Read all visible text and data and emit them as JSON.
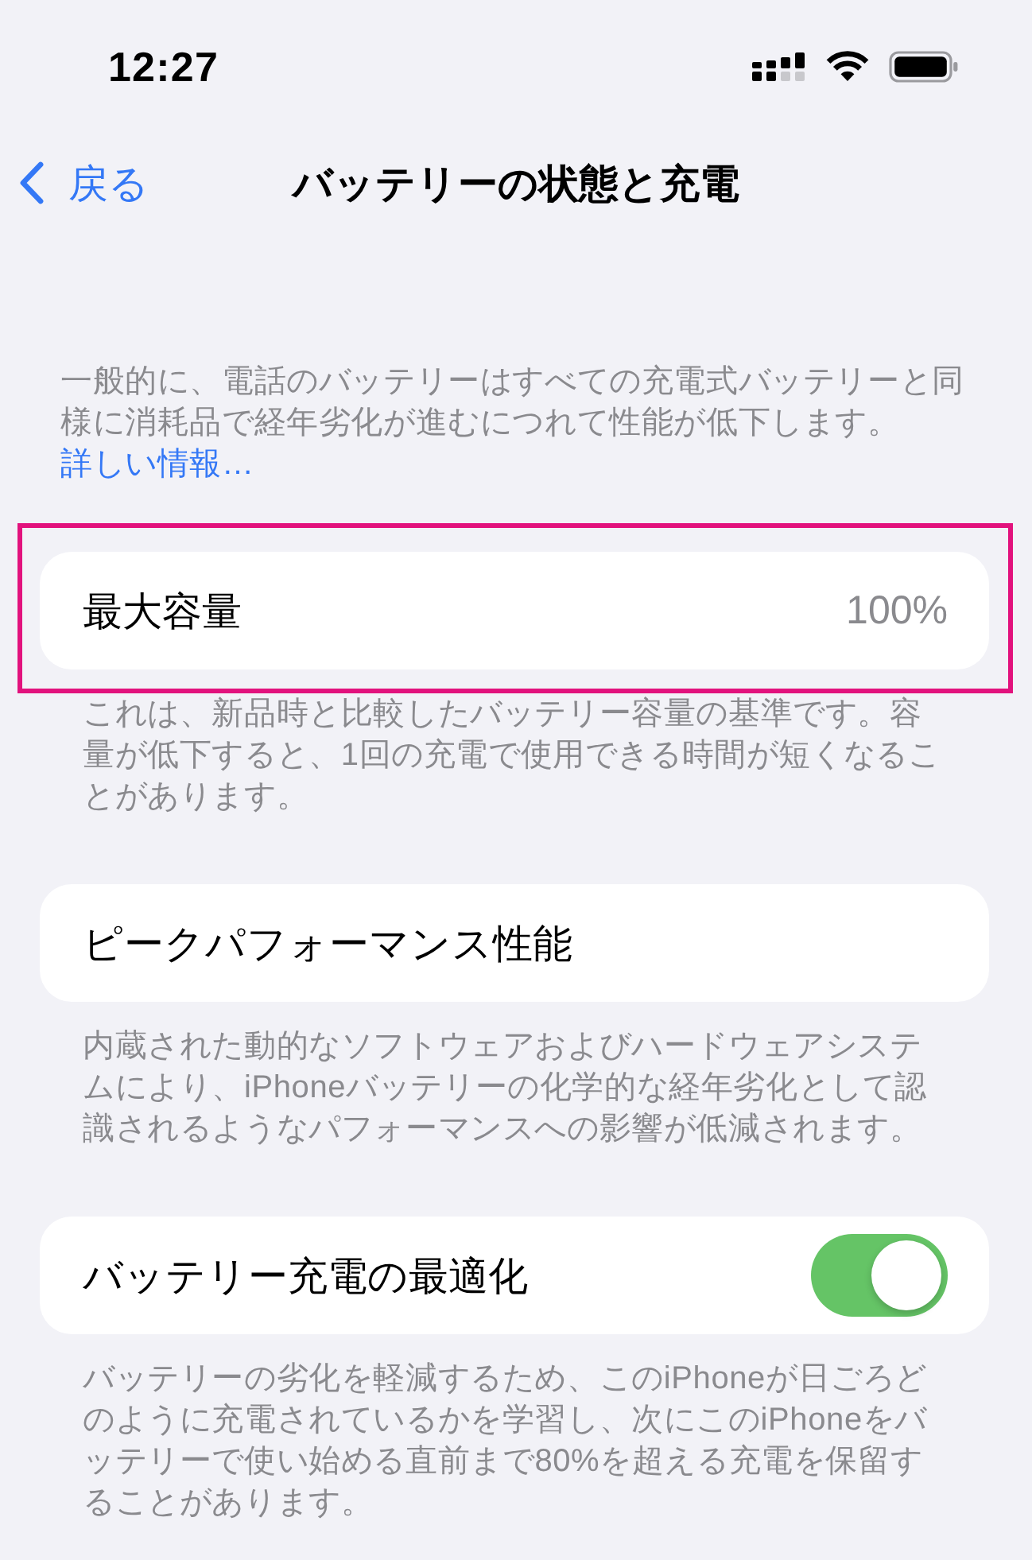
{
  "status_bar": {
    "time": "12:27"
  },
  "nav": {
    "back_label": "戻る",
    "title": "バッテリーの状態と充電"
  },
  "intro": {
    "text": "一般的に、電話のバッテリーはすべての充電式バッテリーと同様に消耗品で経年劣化が進むにつれて性能が低下します。",
    "link": "詳しい情報…"
  },
  "sections": [
    {
      "kind": "value",
      "label": "最大容量",
      "value": "100%",
      "highlighted": true,
      "footer": "これは、新品時と比較したバッテリー容量の基準です。容量が低下すると、1回の充電で使用できる時間が短くなることがあります。"
    },
    {
      "kind": "plain",
      "label": "ピークパフォーマンス性能",
      "highlighted": false,
      "footer": "内蔵された動的なソフトウェアおよびハードウェアシステムにより、iPhoneバッテリーの化学的な経年劣化として認識されるようなパフォーマンスへの影響が低減されます。"
    },
    {
      "kind": "toggle",
      "label": "バッテリー充電の最適化",
      "on": true,
      "highlighted": false,
      "footer": "バッテリーの劣化を軽減するため、このiPhoneが日ごろどのように充電されているかを学習し、次にこのiPhoneをバッテリーで使い始める直前まで80%を超える充電を保留することがあります。"
    }
  ]
}
